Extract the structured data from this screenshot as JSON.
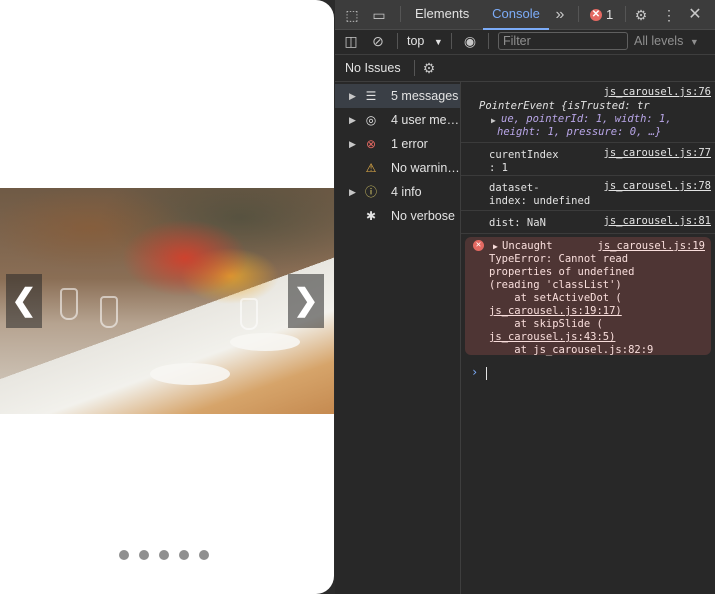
{
  "carousel": {
    "prev": "❮",
    "next": "❯",
    "dots": 5
  },
  "devtools": {
    "tabs": [
      "Elements",
      "Console"
    ],
    "more": "»",
    "error_count": "1",
    "toolbar": {
      "context": "top",
      "filter_placeholder": "Filter",
      "levels": "All levels"
    },
    "issues": "No Issues",
    "sidebar": [
      {
        "label": "5 messages",
        "icon": "list-icon"
      },
      {
        "label": "4 user me…",
        "icon": "user-icon"
      },
      {
        "label": "1 error",
        "icon": "error-icon"
      },
      {
        "label": "No warnin…",
        "icon": "warning-icon"
      },
      {
        "label": "4 info",
        "icon": "info-icon"
      },
      {
        "label": "No verbose",
        "icon": "bug-icon"
      }
    ],
    "messages": [
      {
        "src": "js_carousel.js:76",
        "l1": "PointerEvent {isTrusted: tr",
        "l2": "ue, pointerId: 1, width: 1,",
        "l3": "height: 1, pressure: 0, …}"
      },
      {
        "src": "js_carousel.js:77",
        "l1": "curentIndex",
        "l2": ": 1"
      },
      {
        "src": "js_carousel.js:78",
        "l1": "dataset-",
        "l2": "index: undefined"
      },
      {
        "src": "js_carousel.js:81",
        "l1": "dist: NaN"
      }
    ],
    "error": {
      "src": "js_carousel.js:19",
      "lines": [
        "Uncaught",
        "TypeError: Cannot read",
        "properties of undefined",
        "(reading 'classList')",
        "    at setActiveDot (",
        "js_carousel.js:19:17)",
        "    at skipSlide (",
        "js_carousel.js:43:5)",
        "    at js_carousel.js:82:9"
      ]
    },
    "prompt": "›"
  }
}
